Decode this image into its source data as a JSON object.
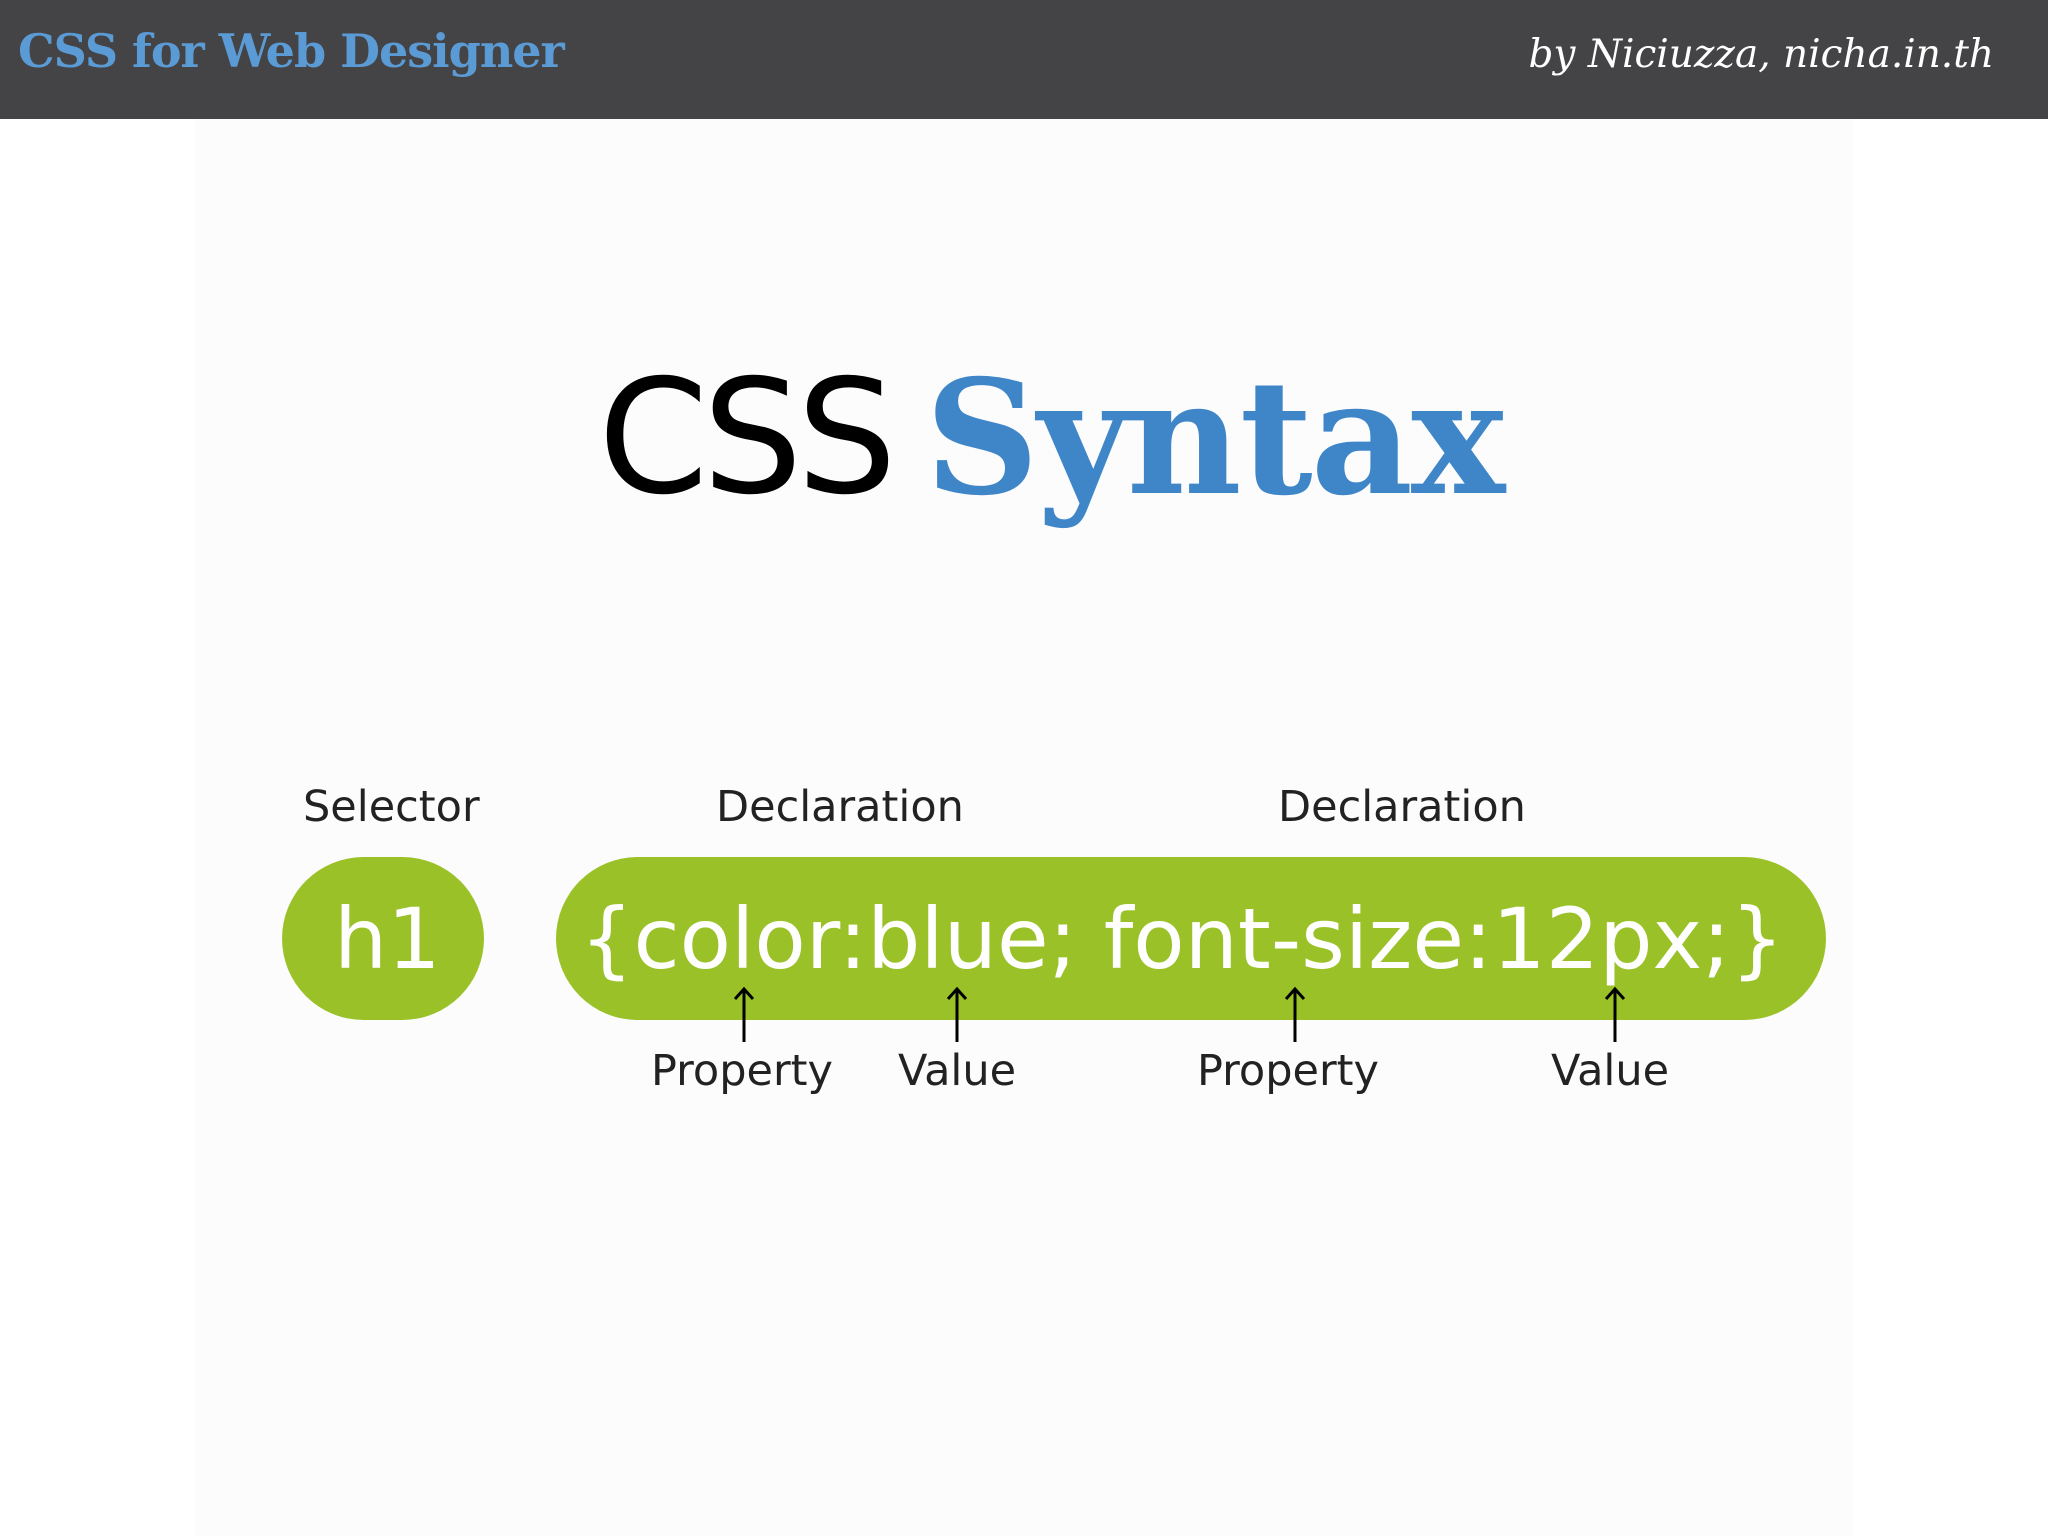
{
  "header": {
    "brand": "CSS for Web Designer",
    "byline": "by  Niciuzza,  nicha.in.th"
  },
  "slide": {
    "title_part_1": "CSS",
    "title_part_2": "Syntax"
  },
  "diagram": {
    "top_labels": [
      "Selector",
      "Declaration",
      "Declaration"
    ],
    "selector": "h1",
    "declaration": "{color:blue; font-size:12px;}",
    "bottom_labels": [
      "Property",
      "Value",
      "Property",
      "Value"
    ],
    "pill_color": "#9ac228",
    "arrow_color": "#000000"
  }
}
